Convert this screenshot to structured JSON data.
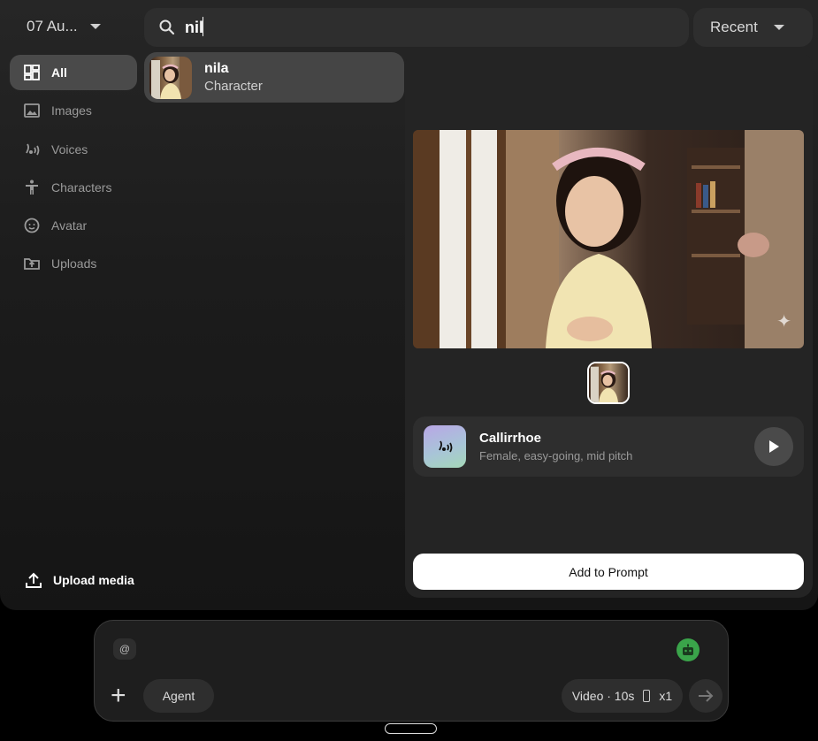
{
  "header": {
    "date_label": "07 Au...",
    "search_value": "nil",
    "sort_label": "Recent"
  },
  "sidebar": {
    "items": [
      {
        "label": "All",
        "icon": "grid-icon",
        "active": true
      },
      {
        "label": "Images",
        "icon": "image-icon"
      },
      {
        "label": "Voices",
        "icon": "voice-icon"
      },
      {
        "label": "Characters",
        "icon": "person-icon"
      },
      {
        "label": "Avatar",
        "icon": "face-icon"
      },
      {
        "label": "Uploads",
        "icon": "folder-upload-icon"
      }
    ],
    "upload_label": "Upload media"
  },
  "result": {
    "name": "nila",
    "type": "Character"
  },
  "preview": {
    "voice_name": "Callirrhoe",
    "voice_desc": "Female, easy-going, mid pitch",
    "add_button": "Add to Prompt"
  },
  "composer": {
    "mention": "@",
    "agent_label": "Agent",
    "video_label": "Video · 10s",
    "count_label": "x1"
  },
  "colors": {
    "accent_green": "#3aa44a",
    "panel_bg": "#1c1c1c"
  }
}
